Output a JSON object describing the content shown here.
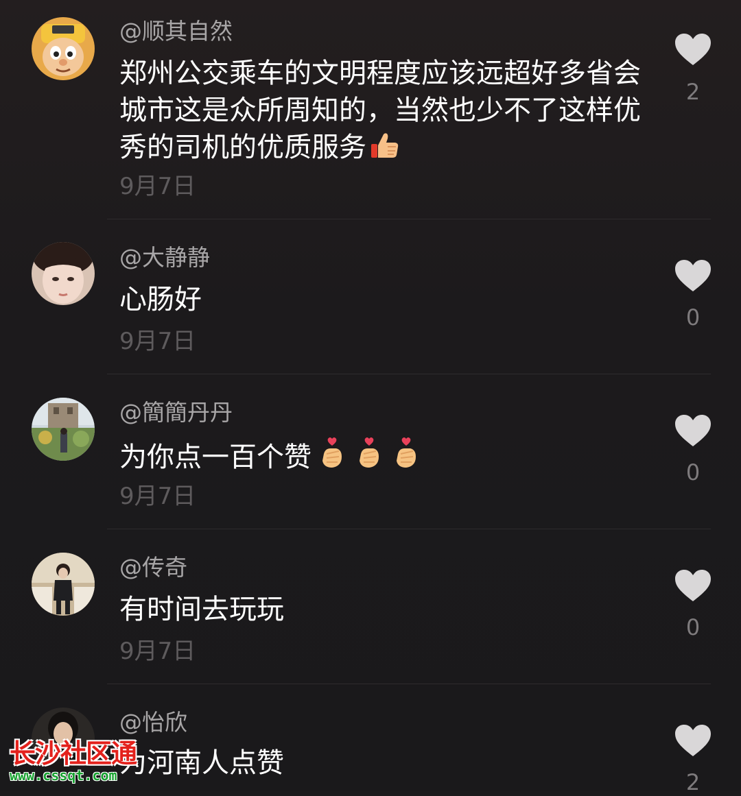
{
  "comments": [
    {
      "username": "@顺其自然",
      "text": "郑州公交乘车的文明程度应该远超好多省会城市这是众所周知的，当然也少不了这样优秀的司机的优质服务",
      "emoji": "thumbs-up",
      "date": "9月7日",
      "likes": "2"
    },
    {
      "username": "@大静静",
      "text": "心肠好",
      "date": "9月7日",
      "likes": "0"
    },
    {
      "username": "@簡簡丹丹",
      "text": "为你点一百个赞",
      "emoji": "finger-heart x3",
      "date": "9月7日",
      "likes": "0"
    },
    {
      "username": "@传奇",
      "text": "有时间去玩玩",
      "date": "9月7日",
      "likes": "0"
    },
    {
      "username": "@怡欣",
      "text": "为河南人点赞",
      "likes": "2"
    }
  ],
  "watermark": {
    "title": "长沙社区通",
    "url": "www.cssqt.com"
  },
  "colors": {
    "background": "#1c1a1c",
    "username": "#a8a6a7",
    "text": "#ffffff",
    "date": "#5e5b5d",
    "like_icon": "#d9d7d8",
    "watermark_red": "#e3211c",
    "watermark_green": "#16a12f"
  }
}
